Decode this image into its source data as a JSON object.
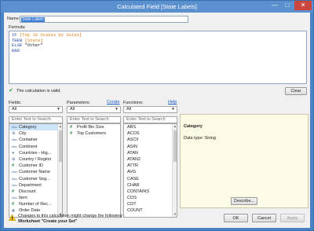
{
  "window": {
    "title": "Calculated Field [State Labels]",
    "minimize_glyph": "—",
    "maximize_glyph": "□",
    "close_glyph": "✕"
  },
  "name": {
    "label": "Name:",
    "value": "State Labels"
  },
  "formula": {
    "label": "Formula:",
    "lines": [
      {
        "kw": "IF",
        "rest": "[Top 10 States by Sales]"
      },
      {
        "kw": "THEN",
        "rest": "[State]"
      },
      {
        "kw": "ELSE",
        "rest": "\"Other\""
      },
      {
        "kw": "END",
        "rest": ""
      }
    ]
  },
  "validation": {
    "message": "The calculation is valid.",
    "clear_label": "Clear"
  },
  "fields": {
    "label": "Fields:",
    "filter": "All",
    "search_placeholder": "Enter Text to Search",
    "items": [
      {
        "icon": "Abc",
        "label": "Category",
        "selected": true
      },
      {
        "icon": "globe",
        "label": "City"
      },
      {
        "icon": "Abc",
        "label": "Container"
      },
      {
        "icon": "Abc",
        "label": "Continent"
      },
      {
        "icon": "globe",
        "label": "Countries - Hig..."
      },
      {
        "icon": "globe",
        "label": "Country / Region"
      },
      {
        "icon": "#",
        "label": "Customer ID"
      },
      {
        "icon": "Abc",
        "label": "Customer Name"
      },
      {
        "icon": "Abc",
        "label": "Customer Seg..."
      },
      {
        "icon": "Abc",
        "label": "Department"
      },
      {
        "icon": "#",
        "label": "Discount"
      },
      {
        "icon": "Abc",
        "label": "Item"
      },
      {
        "icon": "#",
        "label": "Number of Rec..."
      },
      {
        "icon": "cal",
        "label": "Order Date"
      }
    ]
  },
  "parameters": {
    "label": "Parameters:",
    "create_label": "Create",
    "filter": "All",
    "search_placeholder": "Enter Text to Search",
    "items": [
      {
        "icon": "#",
        "label": "Profit Bin Size"
      },
      {
        "icon": "#",
        "label": "Top Customers"
      }
    ]
  },
  "functions": {
    "label": "Functions:",
    "help_label": "Help",
    "filter": "All",
    "search_placeholder": "Enter Text to Search",
    "items": [
      "ABS",
      "ACOS",
      "ASCII",
      "ASIN",
      "ATAN",
      "ATAN2",
      "ATTR",
      "AVG",
      "CASE",
      "CHAR",
      "CONTAINS",
      "COS",
      "COT",
      "COUNT"
    ]
  },
  "help_panel": {
    "title": "Category",
    "type_text": "Data type: String",
    "describe_label": "Describe..."
  },
  "footer": {
    "warning_line1": "Changes to this calculation might change the following:",
    "warning_line2": "Worksheet \"Create your Set\"",
    "ok_label": "OK",
    "cancel_label": "Cancel",
    "apply_label": "Apply"
  },
  "colors": {
    "title_bar": "#5b90cf",
    "close_button": "#c9453d",
    "keyword": "#1a3fa8",
    "field_ref": "#e07a12",
    "valid_check": "#2c9e3c",
    "link": "#1a5cc7",
    "selection": "#cde3f7",
    "help_panel_bg": "#fbfbe6"
  }
}
